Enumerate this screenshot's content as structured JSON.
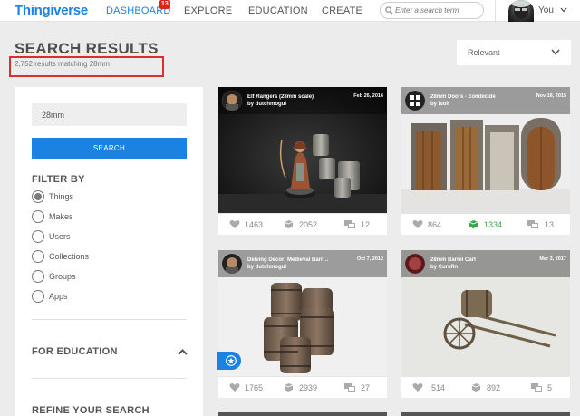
{
  "nav": {
    "logo": "Thingiverse",
    "dashboard": "DASHBOARD",
    "dashboard_badge": "13",
    "explore": "EXPLORE",
    "education": "EDUCATION",
    "create": "CREATE",
    "search_placeholder": "Enter a search term",
    "user": "You"
  },
  "header": {
    "title": "SEARCH RESULTS",
    "count": "2,752 results matching 28mm",
    "sort_selected": "Relevant"
  },
  "sidebar": {
    "search_value": "28mm",
    "search_button": "SEARCH",
    "filter_heading": "FILTER BY",
    "filters": [
      "Things",
      "Makes",
      "Users",
      "Collections",
      "Groups",
      "Apps"
    ],
    "selected_filter": "Things",
    "education_heading": "FOR EDUCATION",
    "refine_heading": "REFINE YOUR SEARCH"
  },
  "cards": [
    {
      "title": "Elf Rangers (28mm scale)",
      "author": "by dutchmogul",
      "date": "Feb 26, 2016",
      "likes": "1463",
      "collections": "2052",
      "comments": "12"
    },
    {
      "title": "28mm Doors - Zombicide",
      "author": "by Isolt",
      "date": "Nov 18, 2015",
      "likes": "864",
      "collections": "1334",
      "comments": "13"
    },
    {
      "title": "Delving Decor: Medieval Barr…",
      "author": "by dutchmogul",
      "date": "Oct 7, 2012",
      "likes": "1765",
      "collections": "2939",
      "comments": "27"
    },
    {
      "title": "28mm Barrel Cart",
      "author": "by Curufin",
      "date": "Mar 3, 2017",
      "likes": "514",
      "collections": "892",
      "comments": "5"
    }
  ],
  "colors": {
    "accent": "#1a82e2",
    "badge": "#d9251d",
    "highlight": "#d9302c",
    "collected": "#3aa64a"
  },
  "icons": [
    "search-icon",
    "chevron-down-icon",
    "heart-icon",
    "collection-icon",
    "comment-icon",
    "featured-star-icon",
    "chevron-up-icon"
  ]
}
